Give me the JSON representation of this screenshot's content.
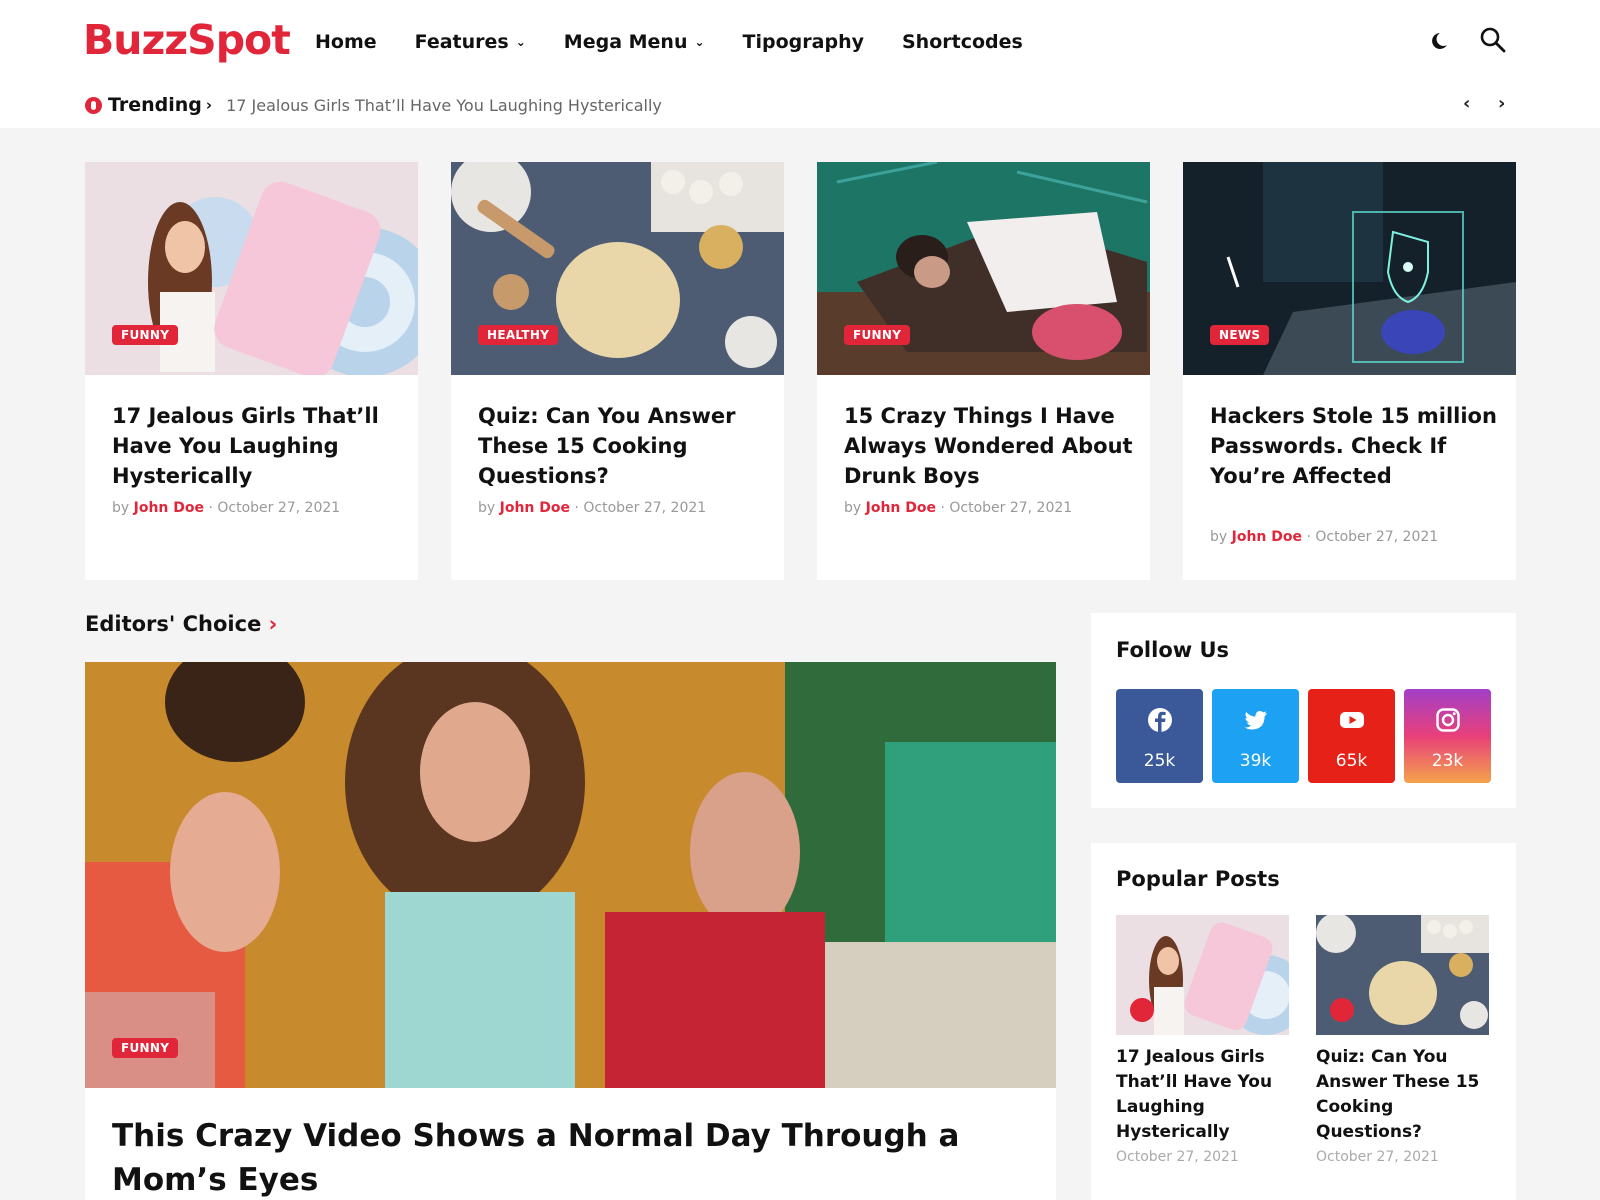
{
  "brand": {
    "name": "BuzzSpot",
    "color": "#e2263a"
  },
  "nav": [
    {
      "label": "Home",
      "dropdown": false
    },
    {
      "label": "Features",
      "dropdown": true
    },
    {
      "label": "Mega Menu",
      "dropdown": true
    },
    {
      "label": "Tipography",
      "dropdown": false
    },
    {
      "label": "Shortcodes",
      "dropdown": false
    }
  ],
  "header_icons": [
    "dark-mode-icon",
    "search-icon"
  ],
  "trending": {
    "label": "Trending",
    "headline": "17 Jealous Girls That’ll Have You Laughing Hysterically"
  },
  "cards": [
    {
      "category": "FUNNY",
      "title": "17 Jealous Girls That’ll Have You Laughing Hysterically",
      "by": "by",
      "author": "John Doe",
      "sep": "·",
      "date": "October 27, 2021"
    },
    {
      "category": "HEALTHY",
      "title": "Quiz: Can You Answer These 15 Cooking Questions?",
      "by": "by",
      "author": "John Doe",
      "sep": "·",
      "date": "October 27, 2021"
    },
    {
      "category": "FUNNY",
      "title": "15 Crazy Things I Have Always Wondered About Drunk Boys",
      "by": "by",
      "author": "John Doe",
      "sep": "·",
      "date": "October 27, 2021"
    },
    {
      "category": "NEWS",
      "title": "Hackers Stole 15 million Passwords. Check If You’re Affected",
      "by": "by",
      "author": "John Doe",
      "sep": "·",
      "date": "October 27, 2021"
    }
  ],
  "editors_choice": {
    "heading": "Editors' Choice",
    "caret": "›",
    "category": "FUNNY",
    "title": "This Crazy Video Shows a Normal Day Through a Mom’s Eyes"
  },
  "follow_us": {
    "title": "Follow Us",
    "networks": [
      {
        "name": "facebook-icon",
        "count": "25k",
        "color": "#3b5998"
      },
      {
        "name": "twitter-icon",
        "count": "39k",
        "color": "#1da1f2"
      },
      {
        "name": "youtube-icon",
        "count": "65k",
        "color": "#e62117"
      },
      {
        "name": "instagram-icon",
        "count": "23k",
        "color": "#c13584"
      }
    ]
  },
  "popular": {
    "title": "Popular Posts",
    "posts": [
      {
        "title": "17 Jealous Girls That’ll Have You Laughing Hysterically",
        "date": "October 27, 2021"
      },
      {
        "title": "Quiz: Can You Answer These 15 Cooking Questions?",
        "date": "October 27, 2021"
      }
    ]
  }
}
